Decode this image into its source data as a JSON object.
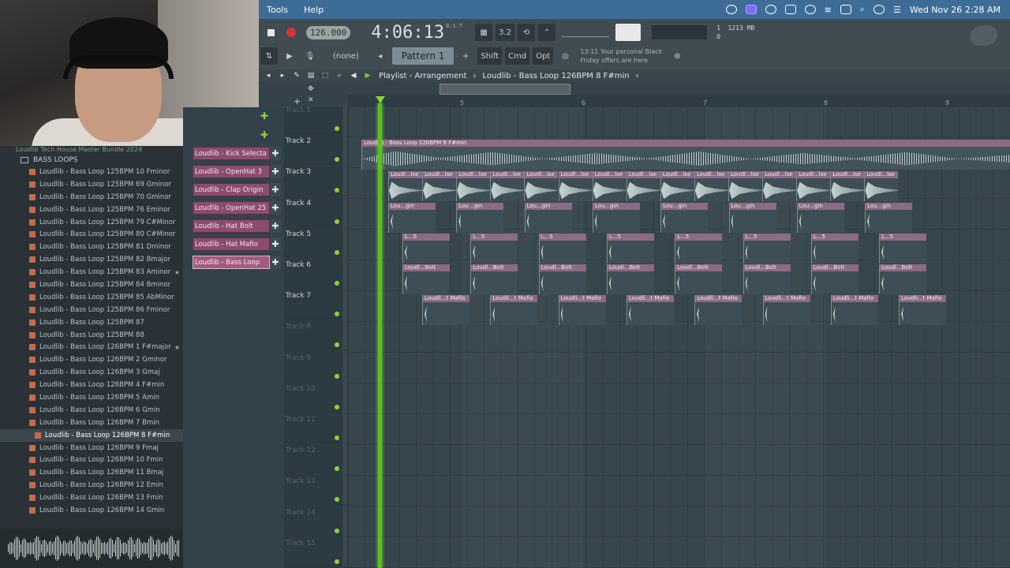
{
  "menubar": {
    "items": [
      "Tools",
      "Help"
    ],
    "datetime": "Wed Nov 26  2:28 AM"
  },
  "transport": {
    "tempo": "126.000",
    "time": "4:06:13",
    "time_sub": "B:S:T",
    "pattern_none": "(none)",
    "pattern": "Pattern 1",
    "shift": "Shift",
    "cmd": "Cmd",
    "opt": "Opt",
    "promo_line1": "13:11  Your personal Black",
    "promo_line2": "Friday offers are here",
    "mem_top": "1213 MB",
    "mem_bottom": "0",
    "cpu": "1"
  },
  "playlist": {
    "title": "Playlist - Arrangement",
    "breadcrumb": "Loudlib - Bass Loop 126BPM 8 F#min",
    "bar_numbers": [
      "5",
      "6",
      "7",
      "8",
      "9"
    ]
  },
  "browser": {
    "top_label": "Loudlib Tech House Master Bundle 2024",
    "folder": "BASS LOOPS",
    "items": [
      {
        "label": "Loudlib - Bass Loop 125BPM 10 Fminor",
        "star": false
      },
      {
        "label": "Loudlib - Bass Loop 125BPM 69 Gminor",
        "star": false
      },
      {
        "label": "Loudlib - Bass Loop 125BPM 70 Gminor",
        "star": false
      },
      {
        "label": "Loudlib - Bass Loop 125BPM 76 Eminor",
        "star": false
      },
      {
        "label": "Loudlib - Bass Loop 125BPM 79 C#Minor",
        "star": false
      },
      {
        "label": "Loudlib - Bass Loop 125BPM 80 C#Minor",
        "star": false
      },
      {
        "label": "Loudlib - Bass Loop 125BPM 81 Dminor",
        "star": false
      },
      {
        "label": "Loudlib - Bass Loop 125BPM 82 Bmajor",
        "star": false
      },
      {
        "label": "Loudlib - Bass Loop 125BPM 83 Aminor",
        "star": true
      },
      {
        "label": "Loudlib - Bass Loop 125BPM 84 Bminor",
        "star": false
      },
      {
        "label": "Loudlib - Bass Loop 125BPM 85 AbMinor",
        "star": false
      },
      {
        "label": "Loudlib - Bass Loop 125BPM 86 Fminor",
        "star": false
      },
      {
        "label": "Loudlib - Bass Loop 125BPM 87",
        "star": false
      },
      {
        "label": "Loudlib - Bass Loop 125BPM 88",
        "star": false
      },
      {
        "label": "Loudlib - Bass Loop 126BPM 1 F#major",
        "star": true
      },
      {
        "label": "Loudlib - Bass Loop 126BPM 2 Gminor",
        "star": false
      },
      {
        "label": "Loudlib - Bass Loop 126BPM 3 Gmaj",
        "star": false
      },
      {
        "label": "Loudlib - Bass Loop 126BPM 4 F#min",
        "star": false
      },
      {
        "label": "Loudlib - Bass Loop 126BPM 5 Amin",
        "star": false
      },
      {
        "label": "Loudlib - Bass Loop 126BPM 6 Gmin",
        "star": false
      },
      {
        "label": "Loudlib - Bass Loop 126BPM 7 Bmin",
        "star": false
      },
      {
        "label": "Loudlib - Bass Loop 126BPM 8 F#min",
        "star": false,
        "selected": true
      },
      {
        "label": "Loudlib - Bass Loop 126BPM 9 Fmaj",
        "star": false
      },
      {
        "label": "Loudlib - Bass Loop 126BPM 10 Fmin",
        "star": false
      },
      {
        "label": "Loudlib - Bass Loop 126BPM 11 Bmaj",
        "star": false
      },
      {
        "label": "Loudlib - Bass Loop 126BPM 12 Emin",
        "star": false
      },
      {
        "label": "Loudlib - Bass Loop 126BPM 13 Fmin",
        "star": false
      },
      {
        "label": "Loudlib - Bass Loop 126BPM 14 Gmin",
        "star": false
      }
    ]
  },
  "channels": [
    {
      "label": "Loudlib - Kick Selecta",
      "selected": false
    },
    {
      "label": "Loudlib - OpenHat 3",
      "selected": false
    },
    {
      "label": "Loudlib - Clap Origin",
      "selected": false
    },
    {
      "label": "Loudlib - OpenHat 25",
      "selected": false
    },
    {
      "label": "Loudlib - Hat Bolt",
      "selected": false
    },
    {
      "label": "Loudlib - Hat Mafio",
      "selected": false
    },
    {
      "label": "Loudlib - Bass Loop",
      "selected": true
    }
  ],
  "tracks": [
    {
      "name": "Track 1",
      "dim": true
    },
    {
      "name": "Track 2",
      "dim": false
    },
    {
      "name": "Track 3",
      "dim": false
    },
    {
      "name": "Track 4",
      "dim": false
    },
    {
      "name": "Track 5",
      "dim": false
    },
    {
      "name": "Track 6",
      "dim": false
    },
    {
      "name": "Track 7",
      "dim": false
    },
    {
      "name": "Track 8",
      "dim": true
    },
    {
      "name": "Track 9",
      "dim": true
    },
    {
      "name": "Track 10",
      "dim": true
    },
    {
      "name": "Track 11",
      "dim": true
    },
    {
      "name": "Track 12",
      "dim": true
    },
    {
      "name": "Track 13",
      "dim": true
    },
    {
      "name": "Track 14",
      "dim": true
    },
    {
      "name": "Track 15",
      "dim": true
    }
  ],
  "clips": {
    "track2": {
      "label": "Loudlib - Bass Loop 126BPM 8 F#min"
    },
    "track3": {
      "label": "Loudl...lse",
      "count": 15
    },
    "track4": {
      "label": "Lou...gin",
      "count": 8
    },
    "track5": {
      "label": "L...5",
      "count": 8
    },
    "track6": {
      "label": "Loudl...Bolt",
      "count": 8
    },
    "track7": {
      "label": "Loudli...t Mafio",
      "count": 8
    }
  }
}
